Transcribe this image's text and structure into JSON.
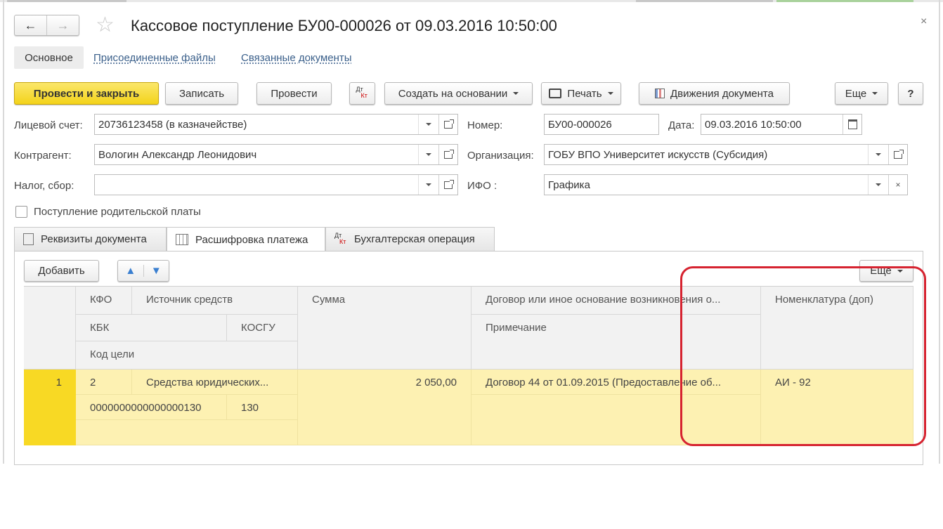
{
  "window": {
    "title": "Кассовое поступление БУ00-000026 от 09.03.2016 10:50:00",
    "close_glyph": "×"
  },
  "nav": {
    "back_glyph": "←",
    "forward_glyph": "→",
    "favorite_glyph": "☆"
  },
  "top_tabs": {
    "main": "Основное",
    "attached_files": "Присоединенные файлы",
    "linked_documents": "Связанные документы"
  },
  "toolbar": {
    "post_close": "Провести и закрыть",
    "save": "Записать",
    "post": "Провести",
    "dtkt_dt": "Дт",
    "dtkt_kt": "Кт",
    "create_based": "Создать на основании",
    "print": "Печать",
    "movements": "Движения документа",
    "more": "Еще",
    "help": "?"
  },
  "form": {
    "account_label": "Лицевой счет:",
    "account_value": "20736123458 (в казначействе)",
    "number_label": "Номер:",
    "number_value": "БУ00-000026",
    "date_label": "Дата:",
    "date_value": "09.03.2016 10:50:00",
    "counterparty_label": "Контрагент:",
    "counterparty_value": "Вологин Александр Леонидович",
    "organization_label": "Организация:",
    "organization_value": "ГОБУ ВПО Университет искусств (Субсидия)",
    "tax_label": "Налог, сбор:",
    "tax_value": "",
    "ifo_label": "ИФО :",
    "ifo_value": "Графика",
    "parent_fee_label": "Поступление родительской платы",
    "parent_fee_checked": false
  },
  "page_tabs": {
    "requisites": "Реквизиты документа",
    "payment_breakdown": "Расшифровка платежа",
    "accounting": "Бухгалтерская операция",
    "accounting_dt": "Дт",
    "accounting_kt": "Кт"
  },
  "table_toolbar": {
    "add": "Добавить",
    "up_glyph": "▲",
    "down_glyph": "▼",
    "more": "Еще"
  },
  "table": {
    "headers": {
      "kfo": "КФО",
      "source": "Источник средств",
      "kbk": "КБК",
      "kosgu": "КОСГУ",
      "goal_code": "Код цели",
      "sum": "Сумма",
      "contract": "Договор или иное основание возникновения о...",
      "note": "Примечание",
      "nomenclature": "Номенклатура (доп)"
    },
    "rows": [
      {
        "num": "1",
        "kfo": "2",
        "source": "Средства юридических...",
        "kbk": "0000000000000000130",
        "kosgu": "130",
        "goal_code": "",
        "sum": "2 050,00",
        "contract": "Договор 44 от 01.09.2015 (Предоставление об...",
        "note": "",
        "nomenclature": "АИ - 92"
      }
    ]
  },
  "colors": {
    "primary_button": "#f3d31a",
    "selected_row": "#fdf1b2",
    "row_marker": "#f8d924",
    "annotation": "#d62330",
    "link": "#3a5f8a"
  }
}
